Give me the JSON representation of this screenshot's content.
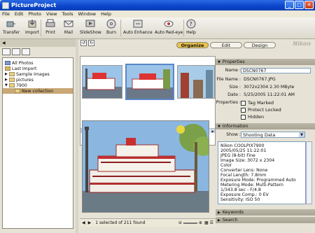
{
  "window": {
    "title": "PictureProject"
  },
  "menu": [
    "File",
    "Edit",
    "Photo",
    "View",
    "Tools",
    "Window",
    "Help"
  ],
  "toolbar": [
    {
      "label": "Transfer",
      "icon": "transfer-icon"
    },
    {
      "label": "Import",
      "icon": "import-icon"
    },
    {
      "label": "Print",
      "icon": "print-icon"
    },
    {
      "label": "Mail",
      "icon": "mail-icon"
    },
    {
      "label": "SlideShow",
      "icon": "slideshow-icon"
    },
    {
      "label": "Burn",
      "icon": "burn-icon"
    },
    {
      "label": "Auto Enhance",
      "icon": "auto-enhance-icon"
    },
    {
      "label": "Auto Red-eye",
      "icon": "red-eye-icon"
    },
    {
      "label": "Help",
      "icon": "help-icon"
    }
  ],
  "modes": {
    "organize": "Organize",
    "edit": "Edit",
    "design": "Design",
    "brand": "Nikon"
  },
  "tree": [
    {
      "label": "All Photos",
      "depth": 0,
      "selected": false
    },
    {
      "label": "Last Import",
      "depth": 0,
      "selected": false
    },
    {
      "label": "Sample Images",
      "depth": 1,
      "selected": false
    },
    {
      "label": "pictures",
      "depth": 1,
      "selected": false
    },
    {
      "label": "7900",
      "depth": 1,
      "selected": false
    },
    {
      "label": "New collection",
      "depth": 2,
      "selected": true
    }
  ],
  "status": {
    "selection": "1 selected of 211 found"
  },
  "properties": {
    "header": "Properties",
    "name_label": "Name :",
    "name_value": "DSCN0767",
    "file_label": "File Name :",
    "file_value": "DSCN0767.JPG",
    "size_label": "Size :",
    "size_value": "3072x2304  2.30 MByte",
    "date_label": "Date :",
    "date_value": "5/25/2005 11:22:01 AM",
    "props_label": "Properties :",
    "tag_marked": "Tag Marked",
    "protect_locked": "Protect Locked",
    "hidden": "Hidden"
  },
  "information": {
    "header": "Information",
    "show_label": "Show :",
    "show_value": "Shooting Data",
    "lines": [
      "Nikon COOLPIX7900",
      "2005/05/25 11:22:01",
      "JPEG (8-bit) Fine",
      "Image Size: 3072 x 2304",
      "Color",
      "Converter Lens: None",
      "Focal Length: 7.8mm",
      "Exposure Mode: Programmed Auto",
      "Metering Mode: Multi-Pattern",
      "1/343.8 sec - F/4.8",
      "Exposure Comp.: 0 EV",
      "Sensitivity: ISO 50"
    ]
  },
  "keywords": {
    "header": "Keywords"
  },
  "search": {
    "header": "Search"
  }
}
